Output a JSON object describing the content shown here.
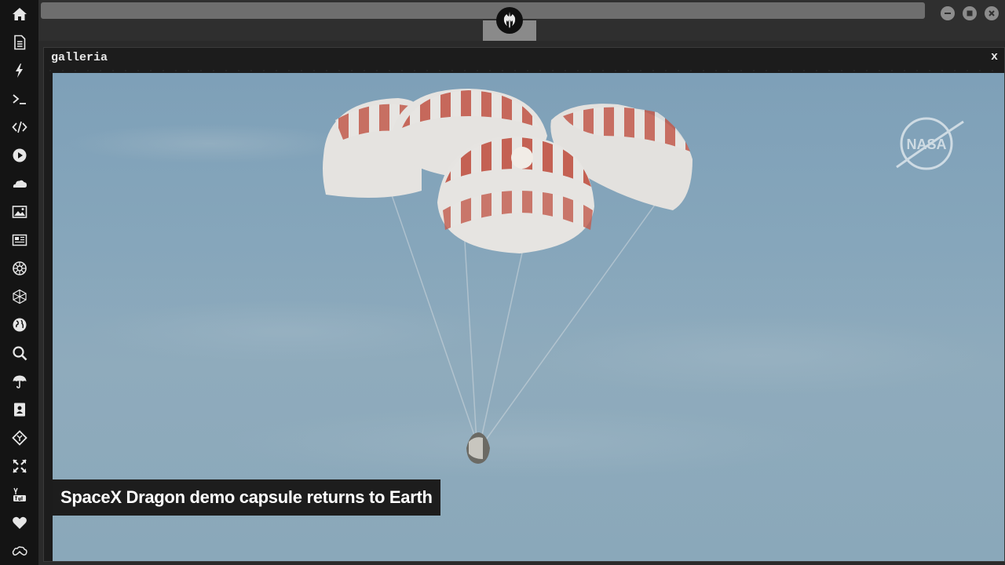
{
  "sidebar": {
    "items": [
      {
        "icon": "home-icon"
      },
      {
        "icon": "document-icon"
      },
      {
        "icon": "lightning-icon"
      },
      {
        "icon": "terminal-icon"
      },
      {
        "icon": "code-icon"
      },
      {
        "icon": "play-icon"
      },
      {
        "icon": "cloud-icon"
      },
      {
        "icon": "image-icon"
      },
      {
        "icon": "newspaper-icon"
      },
      {
        "icon": "empire-icon"
      },
      {
        "icon": "network-icon"
      },
      {
        "icon": "globe-icon"
      },
      {
        "icon": "search-icon"
      },
      {
        "icon": "umbrella-icon"
      },
      {
        "icon": "contact-book-icon"
      },
      {
        "icon": "git-icon"
      },
      {
        "icon": "expand-icon"
      },
      {
        "icon": "youtube-icon"
      },
      {
        "icon": "heart-icon"
      },
      {
        "icon": "infinity-cloud-icon"
      }
    ]
  },
  "topbar": {
    "logo": "rebel-alliance-icon",
    "window_buttons": [
      "minimize-icon",
      "maximize-icon",
      "close-icon"
    ]
  },
  "window": {
    "title": "galleria",
    "close_label": "x"
  },
  "gallery": {
    "caption": "SpaceX Dragon demo capsule returns to Earth",
    "watermark": "NASA"
  },
  "colors": {
    "sidebar_bg": "#141414",
    "panel_bg": "#1c1c1c",
    "sky": "#86a6bb",
    "parachute_red": "#c0574a",
    "parachute_white": "#e9e7e4"
  }
}
